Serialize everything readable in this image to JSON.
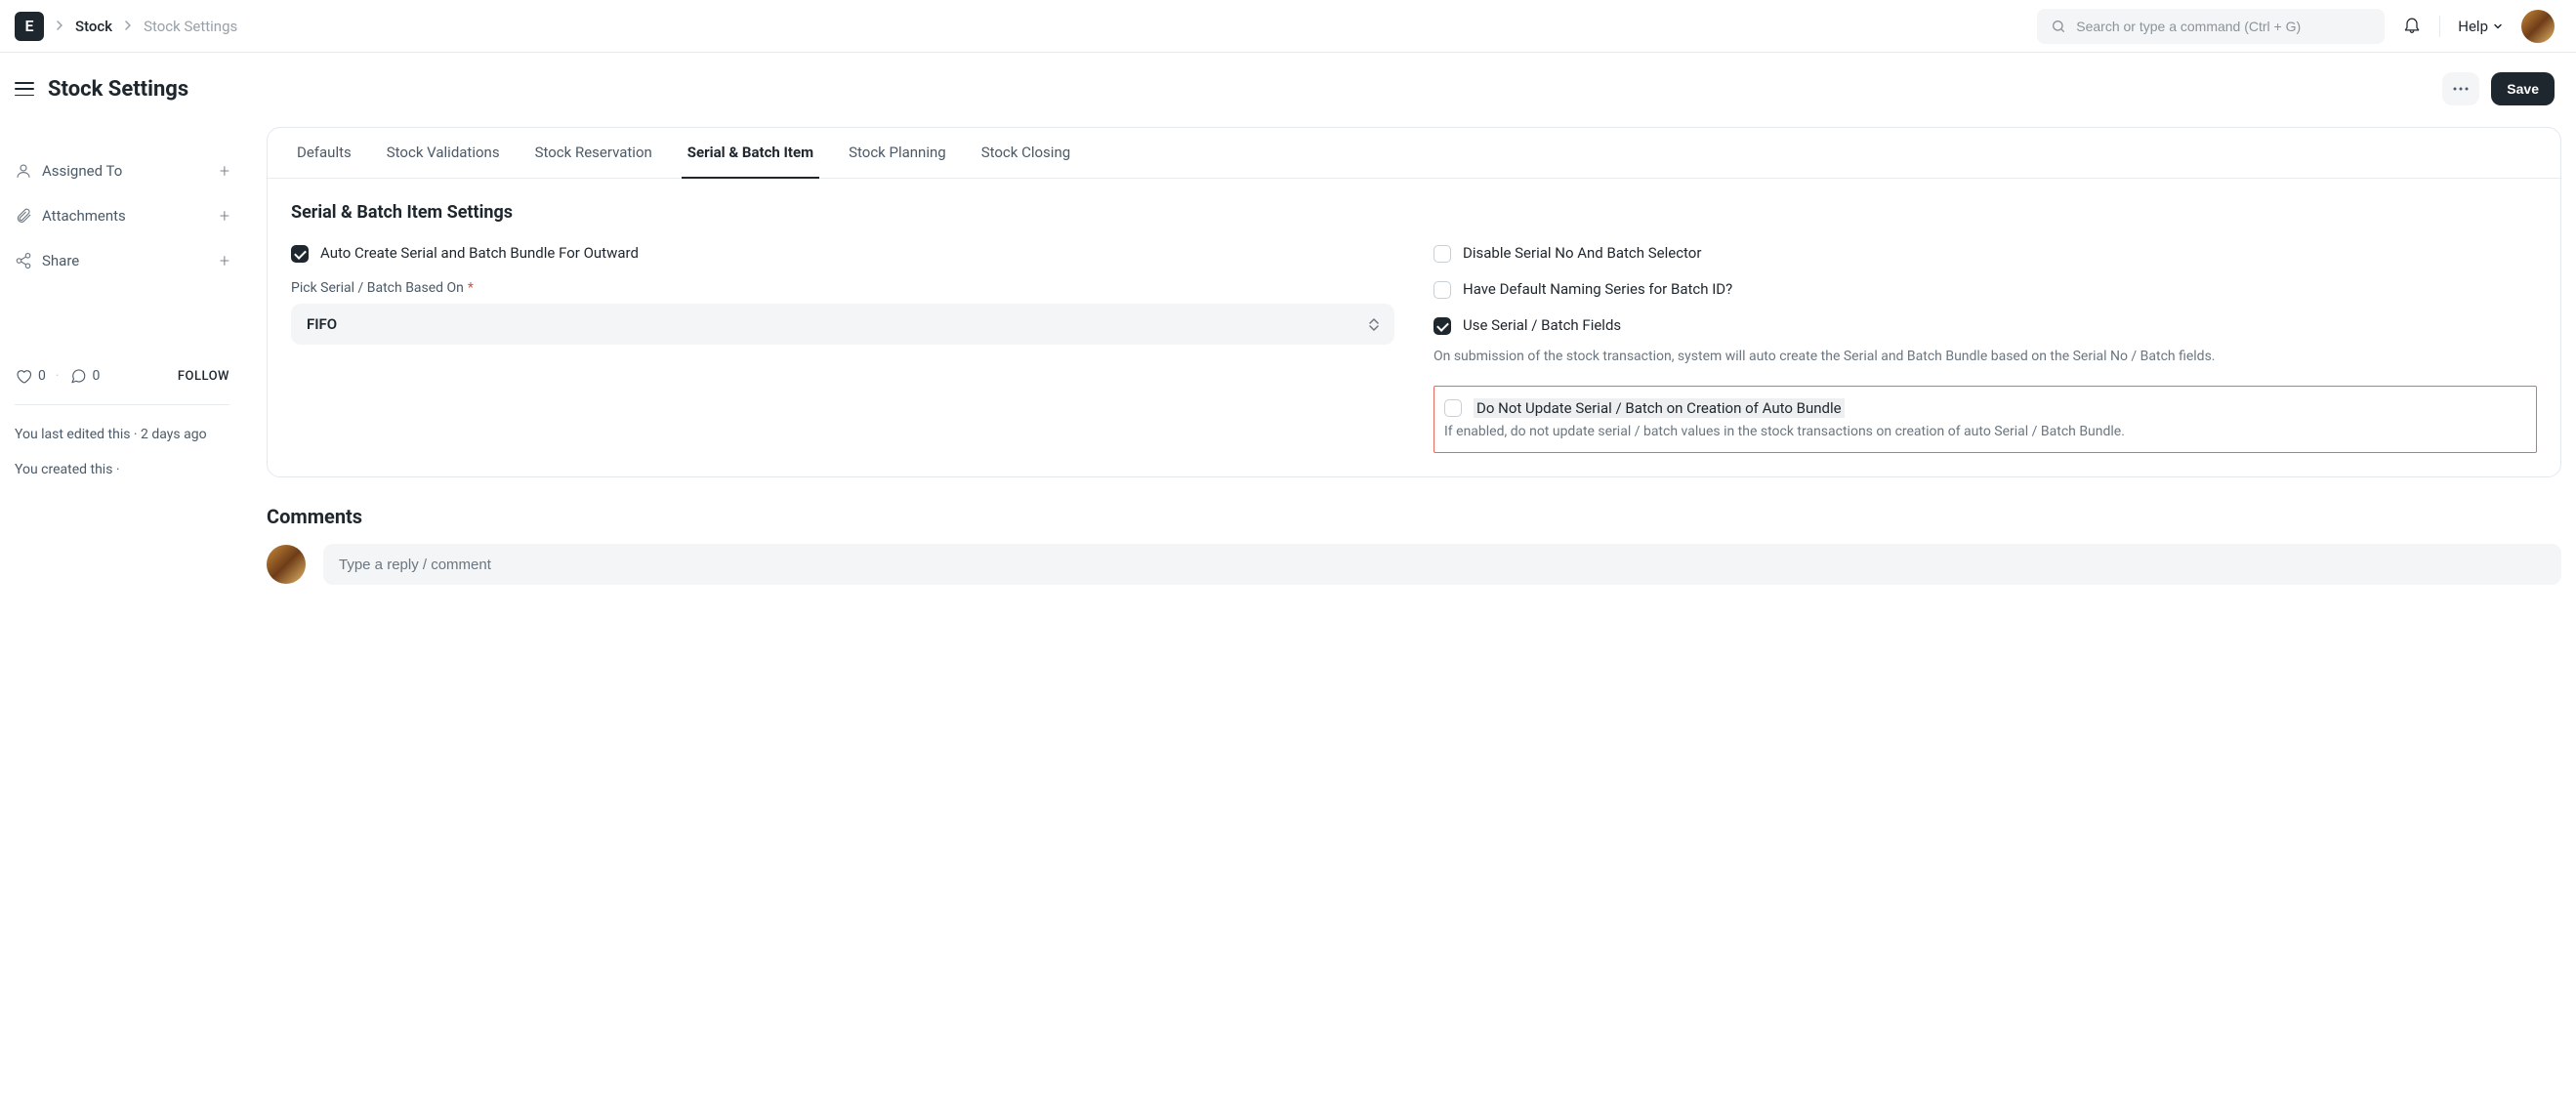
{
  "navbar": {
    "logo_letter": "E",
    "breadcrumbs": [
      "Stock",
      "Stock Settings"
    ],
    "search_placeholder": "Search or type a command (Ctrl + G)",
    "help_label": "Help"
  },
  "page": {
    "title": "Stock Settings",
    "save_label": "Save"
  },
  "sidebar": {
    "assigned_to": "Assigned To",
    "attachments": "Attachments",
    "share": "Share",
    "likes": "0",
    "comments_count": "0",
    "follow": "FOLLOW",
    "last_edited": "You last edited this · 2 days ago",
    "created": "You created this ·"
  },
  "tabs": [
    "Defaults",
    "Stock Validations",
    "Stock Reservation",
    "Serial & Batch Item",
    "Stock Planning",
    "Stock Closing"
  ],
  "active_tab_index": 3,
  "form": {
    "section_title": "Serial & Batch Item Settings",
    "left": {
      "auto_create": {
        "label": "Auto Create Serial and Batch Bundle For Outward",
        "checked": true
      },
      "pick_label": "Pick Serial / Batch Based On",
      "pick_value": "FIFO"
    },
    "right": {
      "disable_selector": {
        "label": "Disable Serial No And Batch Selector",
        "checked": false
      },
      "default_naming": {
        "label": "Have Default Naming Series for Batch ID?",
        "checked": false
      },
      "use_fields": {
        "label": "Use Serial / Batch Fields",
        "checked": true,
        "help": "On submission of the stock transaction, system will auto create the Serial and Batch Bundle based on the Serial No / Batch fields."
      },
      "do_not_update": {
        "label": "Do Not Update Serial / Batch on Creation of Auto Bundle",
        "checked": false,
        "help": "If enabled, do not update serial / batch values in the stock transactions on creation of auto Serial / Batch Bundle."
      }
    }
  },
  "comments": {
    "title": "Comments",
    "placeholder": "Type a reply / comment"
  }
}
